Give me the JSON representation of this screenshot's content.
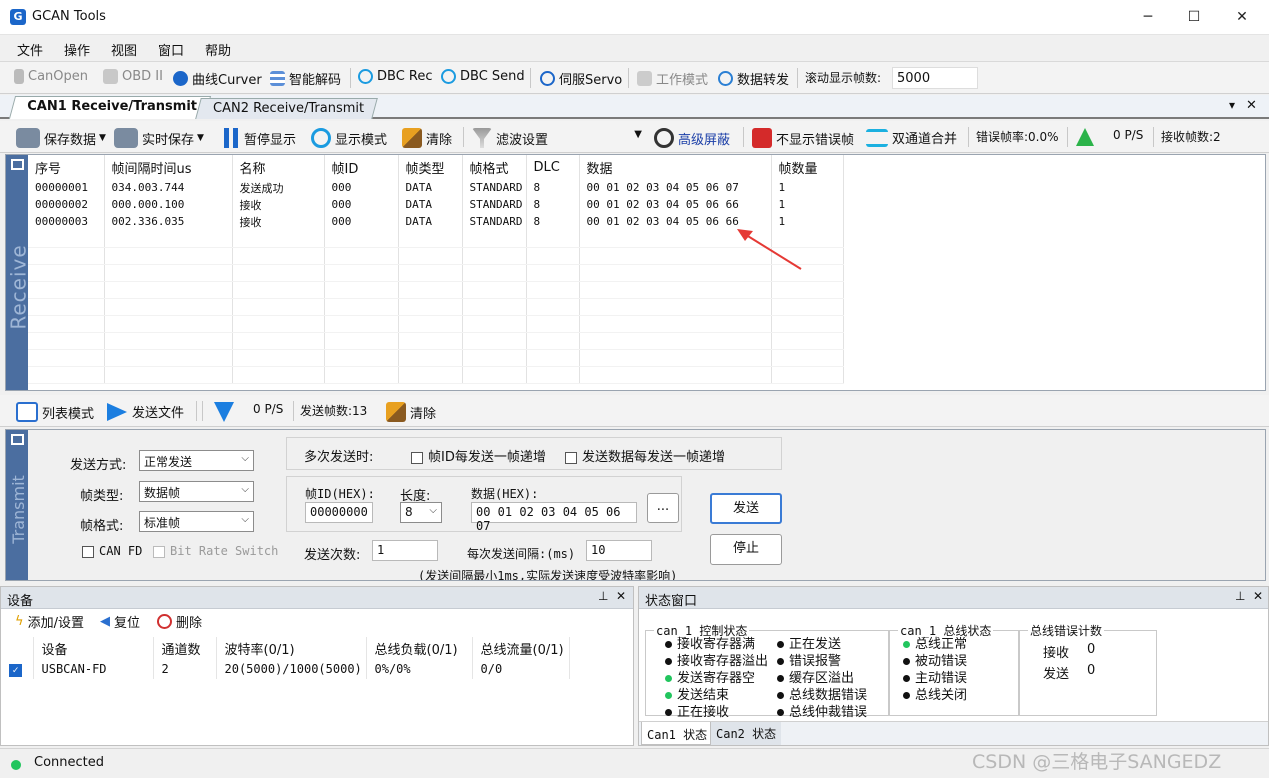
{
  "app": {
    "title": "GCAN Tools",
    "min": "─",
    "max": "☐",
    "close": "✕"
  },
  "menu": [
    "文件",
    "操作",
    "视图",
    "窗口",
    "帮助"
  ],
  "toolbar1": {
    "canopen": "CanOpen",
    "obd": "OBD II",
    "curver": "曲线Curver",
    "decode": "智能解码",
    "dbcrec": "DBC Rec",
    "dbcsend": "DBC Send",
    "servo": "伺服Servo",
    "workmode": "工作模式",
    "forward": "数据转发",
    "scroll_label": "滚动显示帧数:",
    "scroll_value": "5000"
  },
  "tabs": [
    "CAN1 Receive/Transmit",
    "CAN2 Receive/Transmit"
  ],
  "tab_controls": {
    "menu": "▾",
    "close": "✕"
  },
  "toolbar2": {
    "save": "保存数据",
    "realtime": "实时保存",
    "pause": "暂停显示",
    "mode": "显示模式",
    "clear": "清除",
    "filter": "滤波设置",
    "mask": "高级屏蔽",
    "noerr": "不显示错误帧",
    "merge": "双通道合并",
    "errrate": "错误帧率:0.0%",
    "rate": "0 P/S",
    "recvcount": "接收帧数:2"
  },
  "receive": {
    "side_label": "Receive",
    "columns": [
      "序号",
      "帧间隔时间us",
      "名称",
      "帧ID",
      "帧类型",
      "帧格式",
      "DLC",
      "数据",
      "帧数量"
    ],
    "rows": [
      [
        "00000001",
        "034.003.744",
        "发送成功",
        "000",
        "DATA",
        "STANDARD",
        "8",
        "00 01 02 03 04 05 06 07",
        "1"
      ],
      [
        "00000002",
        "000.000.100",
        "接收",
        "000",
        "DATA",
        "STANDARD",
        "8",
        "00 01 02 03 04 05 06 66",
        "1"
      ],
      [
        "00000003",
        "002.336.035",
        "接收",
        "000",
        "DATA",
        "STANDARD",
        "8",
        "00 01 02 03 04 05 06 66",
        "1"
      ]
    ]
  },
  "toolbar3": {
    "listmode": "列表模式",
    "sendfile": "发送文件",
    "rate": "0 P/S",
    "sendcount": "发送帧数:13",
    "clear": "清除"
  },
  "transmit": {
    "side_label": "Transmit",
    "send_mode_label": "发送方式:",
    "send_mode": "正常发送",
    "frame_type_label": "帧类型:",
    "frame_type": "数据帧",
    "frame_format_label": "帧格式:",
    "frame_format": "标准帧",
    "canfd": "CAN FD",
    "brs": "Bit Rate Switch",
    "multi_label": "多次发送时:",
    "inc_id": "帧ID每发送一帧递增",
    "inc_data": "发送数据每发送一帧递增",
    "id_label": "帧ID(HEX):",
    "id_value": "00000000",
    "len_label": "长度:",
    "len_value": "8",
    "data_label": "数据(HEX):",
    "data_value": "00 01 02 03 04 05 06 07",
    "more": "...",
    "count_label": "发送次数:",
    "count_value": "1",
    "interval_label": "每次发送间隔:(ms)",
    "interval_value": "10",
    "note": "(发送间隔最小1ms,实际发送速度受波特率影响)",
    "send": "发送",
    "stop": "停止"
  },
  "device": {
    "title": "设备",
    "pin": "⊥",
    "close": "✕",
    "add": "添加/设置",
    "reset": "复位",
    "delete": "删除",
    "columns": [
      "设备",
      "通道数",
      "波特率(0/1)",
      "总线负载(0/1)",
      "总线流量(0/1)"
    ],
    "rows": [
      [
        "USBCAN-FD",
        "2",
        "20(5000)/1000(5000)",
        "0%/0%",
        "0/0"
      ]
    ]
  },
  "status": {
    "title": "状态窗口",
    "pin": "⊥",
    "close": "✕",
    "ctrl_title": "can_1 控制状态",
    "ctrl_col1": [
      "接收寄存器满",
      "接收寄存器溢出",
      "发送寄存器空",
      "发送结束",
      "正在接收"
    ],
    "ctrl_col1_green": [
      false,
      false,
      true,
      true,
      false
    ],
    "ctrl_col2": [
      "正在发送",
      "错误报警",
      "缓存区溢出",
      "总线数据错误",
      "总线仲裁错误"
    ],
    "bus_title": "can_1 总线状态",
    "bus": [
      "总线正常",
      "被动错误",
      "主动错误",
      "总线关闭"
    ],
    "bus_green": [
      true,
      false,
      false,
      false
    ],
    "err_title": "总线错误计数",
    "rx_label": "接收",
    "rx_value": "0",
    "tx_label": "发送",
    "tx_value": "0",
    "tabs": [
      "Can1 状态",
      "Can2 状态"
    ]
  },
  "statusbar": {
    "text": "Connected"
  },
  "watermark": "CSDN @三格电子SANGEDZ",
  "colors": {
    "accent": "#1b66c9",
    "side": "#4b6ea0",
    "connected": "#22c55e",
    "arrow": "#e53935"
  }
}
